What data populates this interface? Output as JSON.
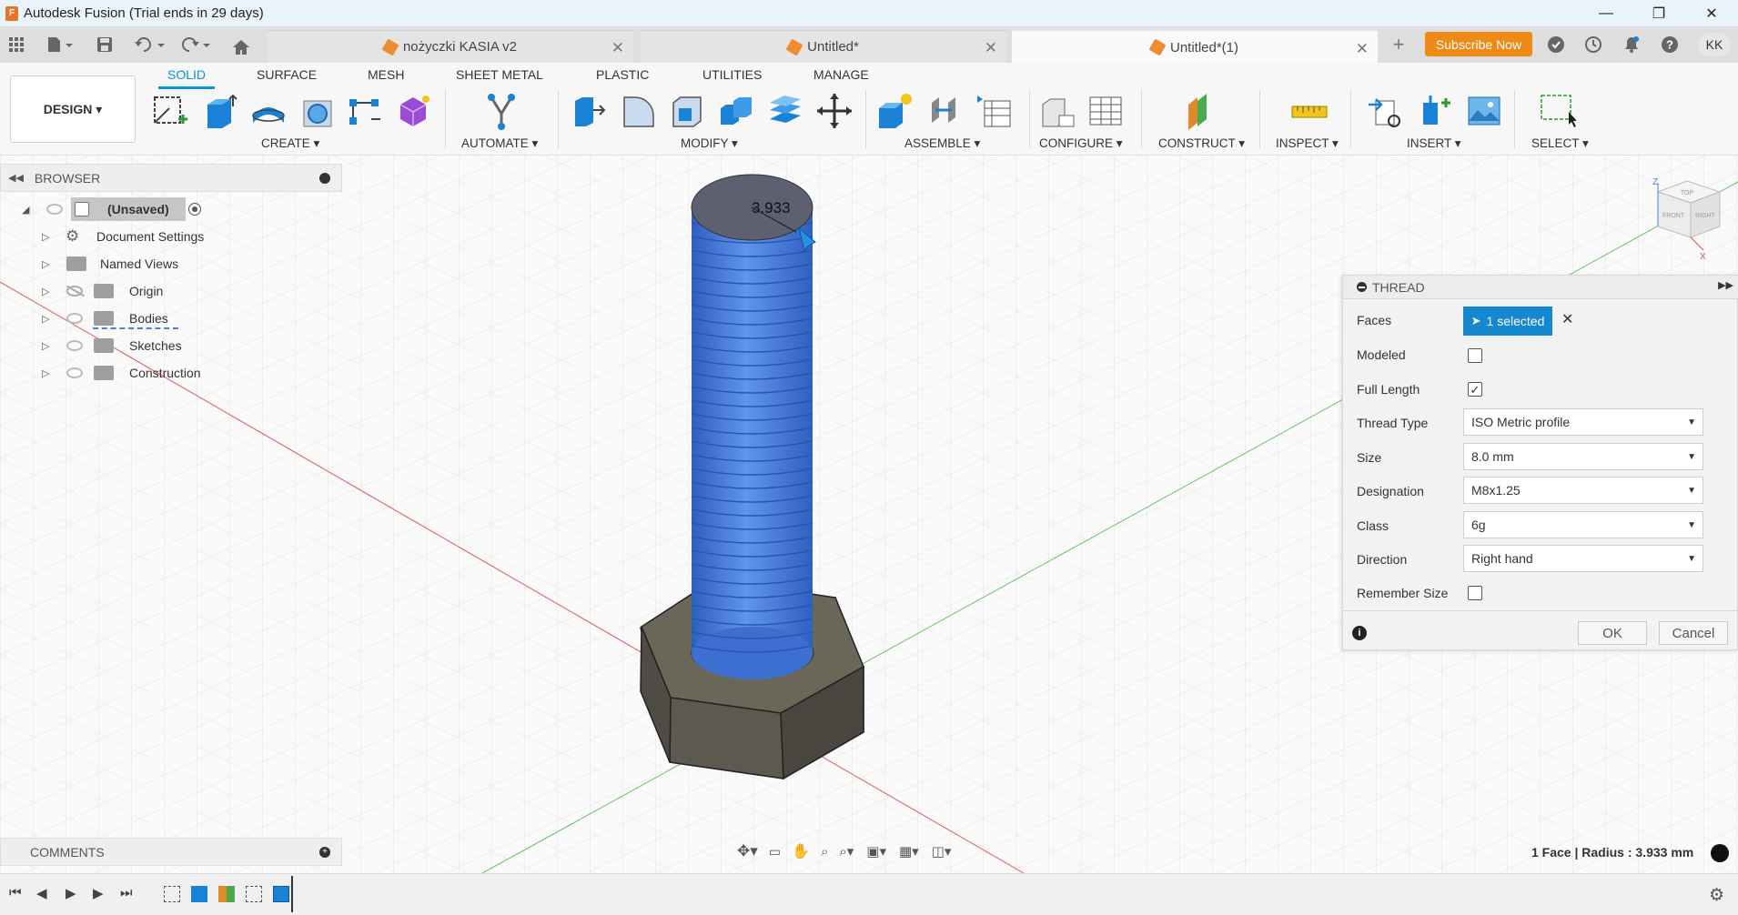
{
  "window": {
    "title": "Autodesk Fusion (Trial ends in 29 days)",
    "controls": [
      "—",
      "❐",
      "✕"
    ]
  },
  "tabs": [
    {
      "label": "nożyczki KASIA v2",
      "active": false
    },
    {
      "label": "Untitled*",
      "active": false
    },
    {
      "label": "Untitled*(1)",
      "active": true
    }
  ],
  "header": {
    "subscribe_label": "Subscribe Now",
    "avatar_initials": "KK"
  },
  "ribbon": {
    "workspace_label": "DESIGN ▾",
    "tabs": [
      "SOLID",
      "SURFACE",
      "MESH",
      "SHEET METAL",
      "PLASTIC",
      "UTILITIES",
      "MANAGE"
    ],
    "active_tab": "SOLID",
    "groups": [
      "CREATE ▾",
      "AUTOMATE ▾",
      "MODIFY ▾",
      "ASSEMBLE ▾",
      "CONFIGURE ▾",
      "CONSTRUCT ▾",
      "INSPECT ▾",
      "INSERT ▾",
      "SELECT ▾"
    ]
  },
  "browser": {
    "title": "BROWSER",
    "root_label": "(Unsaved)",
    "items": [
      {
        "label": "Document Settings",
        "icon": "gear-icon"
      },
      {
        "label": "Named Views",
        "icon": "folder-icon"
      },
      {
        "label": "Origin",
        "icon": "folder-icon",
        "hidden": true
      },
      {
        "label": "Bodies",
        "icon": "folder-icon"
      },
      {
        "label": "Sketches",
        "icon": "folder-icon"
      },
      {
        "label": "Construction",
        "icon": "folder-icon"
      }
    ]
  },
  "viewport": {
    "dimension_label": "3.933",
    "colors": {
      "thread": "#3d74d9",
      "hex_body": "#5a5850",
      "cap": "#60626a"
    }
  },
  "thread_dialog": {
    "title": "THREAD",
    "faces_label": "Faces",
    "faces_value": "1 selected",
    "modeled_label": "Modeled",
    "modeled_checked": false,
    "full_length_label": "Full Length",
    "full_length_checked": true,
    "thread_type_label": "Thread Type",
    "thread_type_value": "ISO Metric profile",
    "size_label": "Size",
    "size_value": "8.0 mm",
    "designation_label": "Designation",
    "designation_value": "M8x1.25",
    "class_label": "Class",
    "class_value": "6g",
    "direction_label": "Direction",
    "direction_value": "Right hand",
    "remember_label": "Remember Size",
    "remember_checked": false,
    "ok_label": "OK",
    "cancel_label": "Cancel"
  },
  "comments": {
    "title": "COMMENTS"
  },
  "status": {
    "text": "1 Face | Radius : 3.933 mm"
  },
  "viewcube": {
    "faces": [
      "TOP",
      "FRONT",
      "RIGHT"
    ],
    "axis_z": "Z",
    "axis_x": "X"
  }
}
